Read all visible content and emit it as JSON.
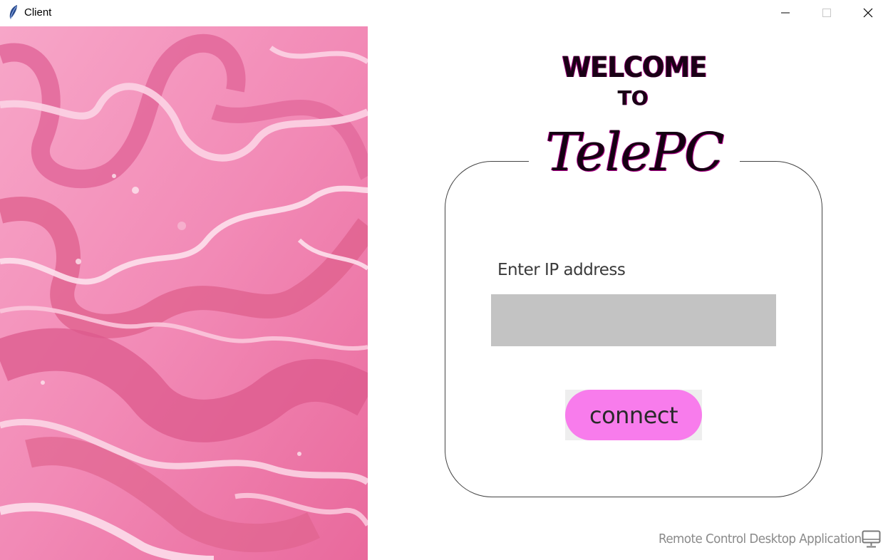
{
  "window": {
    "title": "Client",
    "icon": "feather-icon",
    "controls": [
      "minimize-icon",
      "maximize-icon",
      "close-icon"
    ]
  },
  "hero": {
    "welcome": "WELCOME",
    "to": "TO",
    "brand": "TelePC"
  },
  "form": {
    "ip_label": "Enter IP address",
    "ip_value": "",
    "ip_placeholder": "",
    "connect_label": "connect"
  },
  "footer": {
    "text": "Remote Control Desktop Application",
    "icon": "monitor-icon"
  },
  "colors": {
    "accent": "#f87cec",
    "input_bg": "#c3c3c3",
    "marble_base": "#f48ab8",
    "marble_dark": "#e0608f",
    "heading": "#1a0016"
  }
}
